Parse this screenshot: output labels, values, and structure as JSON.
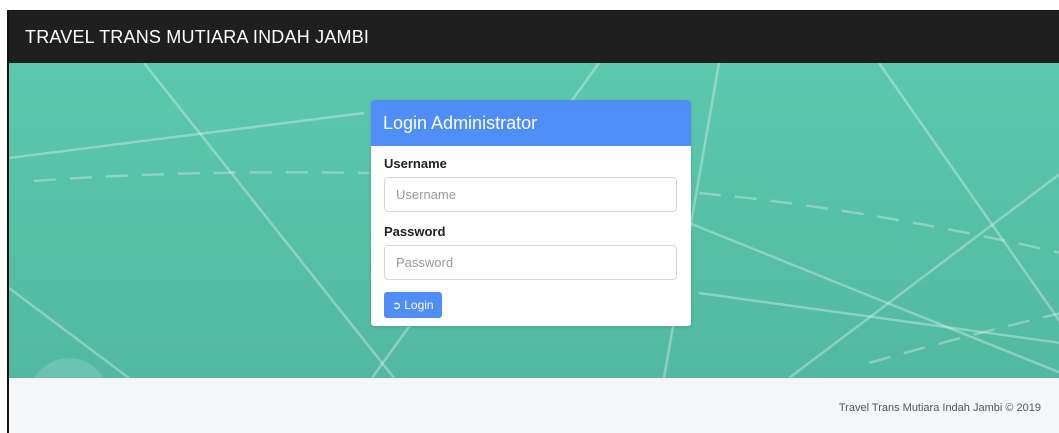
{
  "navbar": {
    "brand": "TRAVEL TRANS MUTIARA INDAH JAMBI"
  },
  "login": {
    "title": "Login Administrator",
    "username_label": "Username",
    "username_placeholder": "Username",
    "username_value": "",
    "password_label": "Password",
    "password_placeholder": "Password",
    "password_value": "",
    "button_label": "Login",
    "button_icon": "sign-in-icon"
  },
  "footer": {
    "text": "Travel Trans Mutiara Indah Jambi © 2019"
  },
  "colors": {
    "navbar_bg": "#1f1f1f",
    "hero_bg": "#56c0a5",
    "accent": "#4f8df7",
    "footer_bg": "#f5f6f8"
  }
}
